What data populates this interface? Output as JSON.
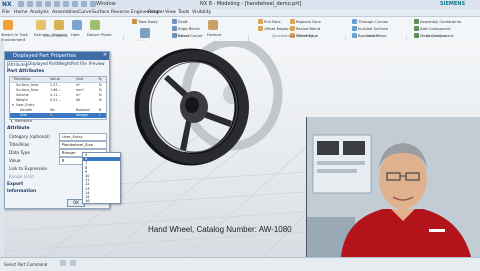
{
  "title_bar": {
    "logo": "NX",
    "window_label": "Window",
    "title": "NX 8 - Modeling - [handwheel_demo.prt]",
    "brand": "SIEMENS"
  },
  "menu": [
    "File",
    "Home",
    "Analysis",
    "Assemblies",
    "Curve",
    "Surface",
    "Reverse Engineering",
    "Render",
    "View",
    "Tools",
    "Visibility"
  ],
  "ribbon": {
    "buttons": [
      "Sketch in Task Environment",
      "Extrude",
      "Revolve",
      "Hole",
      "Datum Plane",
      "Tube Body",
      "Draft",
      "Edge Blend",
      "Blend Corner",
      "Unite",
      "Feature",
      "Pull Face",
      "Offset Region",
      "Replace Face",
      "Resize Blend",
      "Offset Edge",
      "Through Curves",
      "N-sided Surface",
      "Bounded Plane",
      "Assembly Constraints",
      "Add Component",
      "Move Component"
    ],
    "groups": [
      "Direct Sketch",
      "Feature",
      "Synchronous Modeling",
      "Surface",
      "Assemblies"
    ]
  },
  "dialog": {
    "title": "Displayed Part Properties",
    "tabs": [
      "Attributes",
      "Displayed Part",
      "Weight",
      "Part File",
      "Preview"
    ],
    "section_attributes": "Part Attributes",
    "tree_headers": [
      "Title/Alias",
      "Value",
      "Unit",
      "Ty"
    ],
    "tree_rows": [
      {
        "title": "Surface_Area",
        "value": "2.57...",
        "unit": "in²",
        "type": "N"
      },
      {
        "title": "Surface_Area",
        "value": "1.66...",
        "unit": "mm²",
        "type": "N"
      },
      {
        "title": "Volume",
        "value": "4.11...",
        "unit": "in³",
        "type": "N"
      },
      {
        "title": "Weight",
        "value": "0.51...",
        "unit": "lbf",
        "type": "N"
      },
      {
        "title": "User_Entry",
        "value": "",
        "unit": "",
        "type": ""
      },
      {
        "title": "Handle",
        "value": "No",
        "unit": "Boolean",
        "type": "B"
      },
      {
        "title": "Size",
        "value": "6",
        "unit": "Integer",
        "type": "I"
      },
      {
        "title": "Reference",
        "value": "",
        "unit": "",
        "type": ""
      }
    ],
    "section_attribute": "Attribute",
    "category_label": "Category (optional)",
    "category_value": "User_Entry",
    "title_label": "Title/Alias",
    "title_value": "Handwheel_Size",
    "data_type_label": "Data Type",
    "data_type_value": "Integer",
    "value_label": "Value",
    "value_value": "6",
    "link_label": "Link to Expression",
    "range_label": "Range Limit",
    "export_label": "Export",
    "information_label": "Information",
    "ok_label": "OK"
  },
  "dropdown": {
    "options": [
      "4",
      "6",
      "7",
      "8",
      "9",
      "10",
      "11",
      "12",
      "13",
      "14",
      "15",
      "16"
    ],
    "selected_index": 1
  },
  "viewport": {
    "caption": "Hand Wheel, Catalog Number:  AW-1080"
  },
  "status_bar": {
    "text": "Select Part Command"
  },
  "colors": {
    "wheel": "#2a2b2e",
    "highlight": "#3b78c4",
    "title_blue": "#3d6ea5",
    "shirt_red": "#b3131b"
  }
}
